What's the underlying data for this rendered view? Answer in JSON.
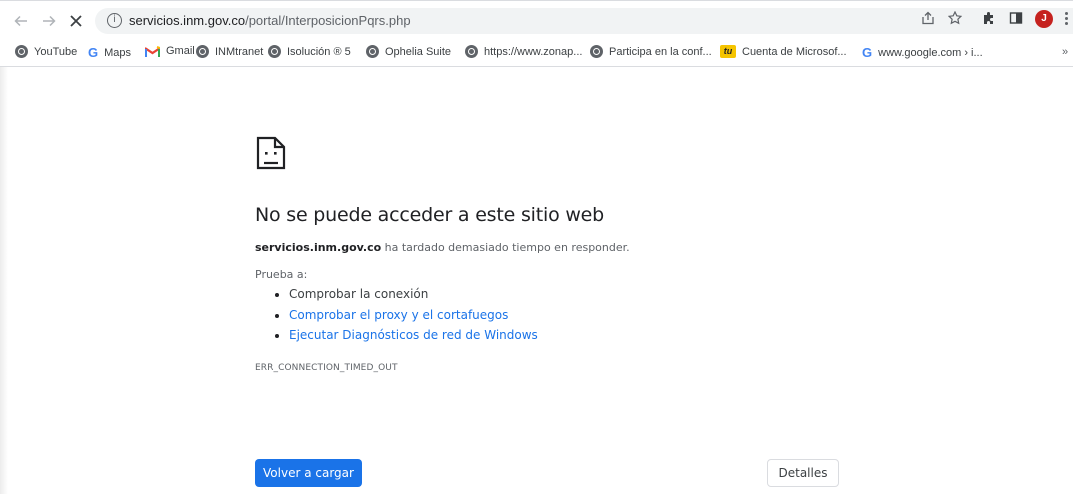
{
  "browser": {
    "url_host": "servicios.inm.gov.co",
    "url_path": "/portal/InterposicionPqrs.php",
    "nav": {
      "back_icon": "arrow-left-icon",
      "forward_icon": "arrow-right-icon",
      "stop_icon": "close-icon",
      "info_icon": "info-icon"
    },
    "toolbar_icons": [
      "share-icon",
      "star-icon",
      "extensions-icon",
      "side-panel-icon"
    ],
    "profile_initial": "J",
    "profile_color": "#c5221f"
  },
  "bookmarks": [
    {
      "label": "YouTube",
      "icon": "globe-icon"
    },
    {
      "label": "Maps",
      "icon": "google-icon"
    },
    {
      "label": "Gmail",
      "icon": "gmail-icon"
    },
    {
      "label": "INMtranet",
      "icon": "globe-icon"
    },
    {
      "label": "Isolución ® 5",
      "icon": "globe-icon"
    },
    {
      "label": "Ophelia Suite",
      "icon": "globe-icon"
    },
    {
      "label": "https://www.zonap...",
      "icon": "globe-icon"
    },
    {
      "label": "Participa en la conf...",
      "icon": "globe-icon"
    },
    {
      "label": "Cuenta de Microsof...",
      "icon": "tu-icon"
    },
    {
      "label": "www.google.com › i...",
      "icon": "google-icon"
    }
  ],
  "bookmarks_more": "»",
  "error_page": {
    "title": "No se puede acceder a este sitio web",
    "host": "servicios.inm.gov.co",
    "description": " ha tardado demasiado tiempo en responder.",
    "try_label": "Prueba a:",
    "suggestions": [
      "Comprobar la conexión",
      "Comprobar el proxy y el cortafuegos",
      "Ejecutar Diagnósticos de red de Windows"
    ],
    "error_code": "ERR_CONNECTION_TIMED_OUT",
    "reload_button": "Volver a cargar",
    "details_button": "Detalles",
    "accent_color": "#1a73e8"
  }
}
